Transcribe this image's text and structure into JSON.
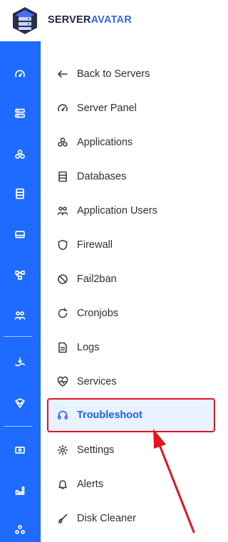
{
  "brand": {
    "part1": "SERVER",
    "part2": "AVATAR",
    "accent_color": "#3b63f6"
  },
  "rail": {
    "color": "#1f6bff",
    "icons": [
      "gauge-icon",
      "server-icon",
      "apps-icon",
      "database-icon",
      "drive-icon",
      "network-icon",
      "users-icon",
      "deploy-icon",
      "shield-icon",
      "storage-icon",
      "chart-icon",
      "integrations-icon"
    ]
  },
  "menu": {
    "items": [
      {
        "label": "Back to Servers",
        "icon": "arrow-left-icon"
      },
      {
        "label": "Server Panel",
        "icon": "gauge-icon"
      },
      {
        "label": "Applications",
        "icon": "apps-icon"
      },
      {
        "label": "Databases",
        "icon": "database-icon"
      },
      {
        "label": "Application Users",
        "icon": "users-icon"
      },
      {
        "label": "Firewall",
        "icon": "shield-icon"
      },
      {
        "label": "Fail2ban",
        "icon": "ban-icon"
      },
      {
        "label": "Cronjobs",
        "icon": "refresh-icon"
      },
      {
        "label": "Logs",
        "icon": "file-icon"
      },
      {
        "label": "Services",
        "icon": "heartbeat-icon"
      },
      {
        "label": "Troubleshoot",
        "icon": "headset-icon",
        "active": true
      },
      {
        "label": "Settings",
        "icon": "gear-icon"
      },
      {
        "label": "Alerts",
        "icon": "bell-icon"
      },
      {
        "label": "Disk Cleaner",
        "icon": "broom-icon"
      }
    ]
  },
  "colors": {
    "active_bg": "#eaf2ff",
    "active_text": "#1f5fff",
    "highlight_border": "#e5141f",
    "arrow": "#e5141f"
  }
}
